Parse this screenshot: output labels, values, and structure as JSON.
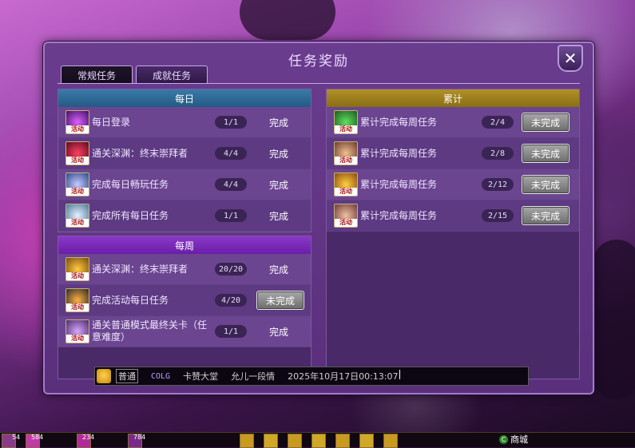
{
  "window": {
    "title": "任务奖励",
    "close_label": "✕"
  },
  "tabs": [
    {
      "label": "常规任务",
      "active": true
    },
    {
      "label": "成就任务",
      "active": false
    }
  ],
  "daily": {
    "header": "每日",
    "tasks": [
      {
        "icon": "daily-login-icon",
        "name": "每日登录",
        "progress": "1/1",
        "status": "完成"
      },
      {
        "icon": "abyss-icon",
        "name": "通关深渊：终末崇拜者",
        "progress": "4/4",
        "status": "完成"
      },
      {
        "icon": "play-icon",
        "name": "完成每日畅玩任务",
        "progress": "4/4",
        "status": "完成"
      },
      {
        "icon": "all-daily-icon",
        "name": "完成所有每日任务",
        "progress": "1/1",
        "status": "完成"
      }
    ]
  },
  "weekly": {
    "header": "每周",
    "tasks": [
      {
        "icon": "abyss-weekly-icon",
        "name": "通关深渊：终末崇拜者",
        "progress": "20/20",
        "status": "完成"
      },
      {
        "icon": "potion-icon",
        "name": "完成活动每日任务",
        "progress": "4/20",
        "status": "未完成"
      },
      {
        "icon": "normal-mode-icon",
        "name": "通关普通模式最终关卡（任意难度）",
        "progress": "1/1",
        "status": "完成"
      }
    ]
  },
  "cumulative": {
    "header": "累计",
    "tasks": [
      {
        "icon": "cumulative-icon-1",
        "name": "累计完成每周任务",
        "progress": "2/4",
        "status": "未完成"
      },
      {
        "icon": "cumulative-icon-2",
        "name": "累计完成每周任务",
        "progress": "2/8",
        "status": "未完成"
      },
      {
        "icon": "cumulative-icon-3",
        "name": "累计完成每周任务",
        "progress": "2/12",
        "status": "未完成"
      },
      {
        "icon": "cumulative-icon-4",
        "name": "累计完成每周任务",
        "progress": "2/15",
        "status": "未完成"
      }
    ]
  },
  "activity_tag": "活动",
  "chat": {
    "channel": "普通",
    "source": "COLG",
    "text1": "卡赞大堂",
    "text2": "允儿一段情",
    "timestamp": "2025年10月17日00:13:07"
  },
  "hotbar": {
    "slot_counts": [
      "54",
      "584",
      "234",
      "784"
    ],
    "shop_label": "商城"
  },
  "colors": {
    "daily_header": "#2f6c98",
    "weekly_header": "#7a2cb8",
    "cumulative_header": "#9c7e1c",
    "window_bg": "#5a2f7c",
    "incomplete_button": "#8a8a8a"
  }
}
